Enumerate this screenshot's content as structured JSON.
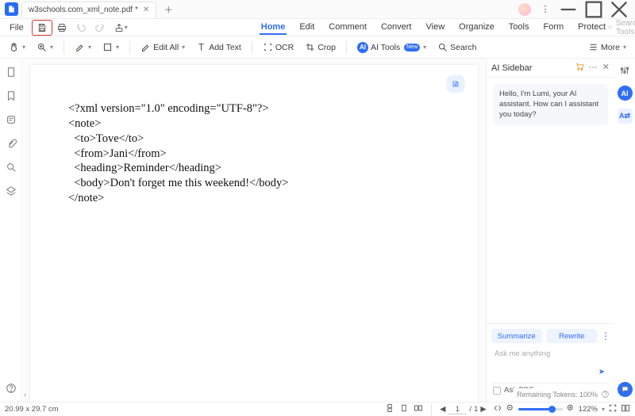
{
  "titlebar": {
    "tab_label": "w3schools.com_xml_note.pdf *"
  },
  "quickbar": {
    "file_label": "File"
  },
  "menu": {
    "items": [
      "Home",
      "Edit",
      "Comment",
      "Convert",
      "View",
      "Organize",
      "Tools",
      "Form",
      "Protect"
    ],
    "active_index": 0,
    "search_placeholder": "Search Tools"
  },
  "ribbon": {
    "edit_all": "Edit All",
    "add_text": "Add Text",
    "ocr": "OCR",
    "crop": "Crop",
    "ai_tools": "AI Tools",
    "ai_new": "New",
    "search": "Search",
    "more": "More"
  },
  "document": {
    "lines": [
      "<?xml version=\"1.0\" encoding=\"UTF-8\"?>",
      "<note>",
      "  <to>Tove</to>",
      "  <from>Jani</from>",
      "  <heading>Reminder</heading>",
      "  <body>Don't forget me this weekend!</body>",
      "</note>"
    ]
  },
  "ai": {
    "title": "AI Sidebar",
    "greeting": "Hello, I'm Lumi, your AI assistant. How can I assistant you today?",
    "summarize": "Summarize",
    "rewrite": "Rewrite",
    "ask_placeholder": "Ask me anything",
    "ask_pdf": "Ask PDF",
    "tokens_label": "Remaining Tokens: 100%"
  },
  "status": {
    "dimensions": "20.99 x 29.7 cm",
    "page_current": "1",
    "page_total": "1",
    "zoom": "122%"
  }
}
